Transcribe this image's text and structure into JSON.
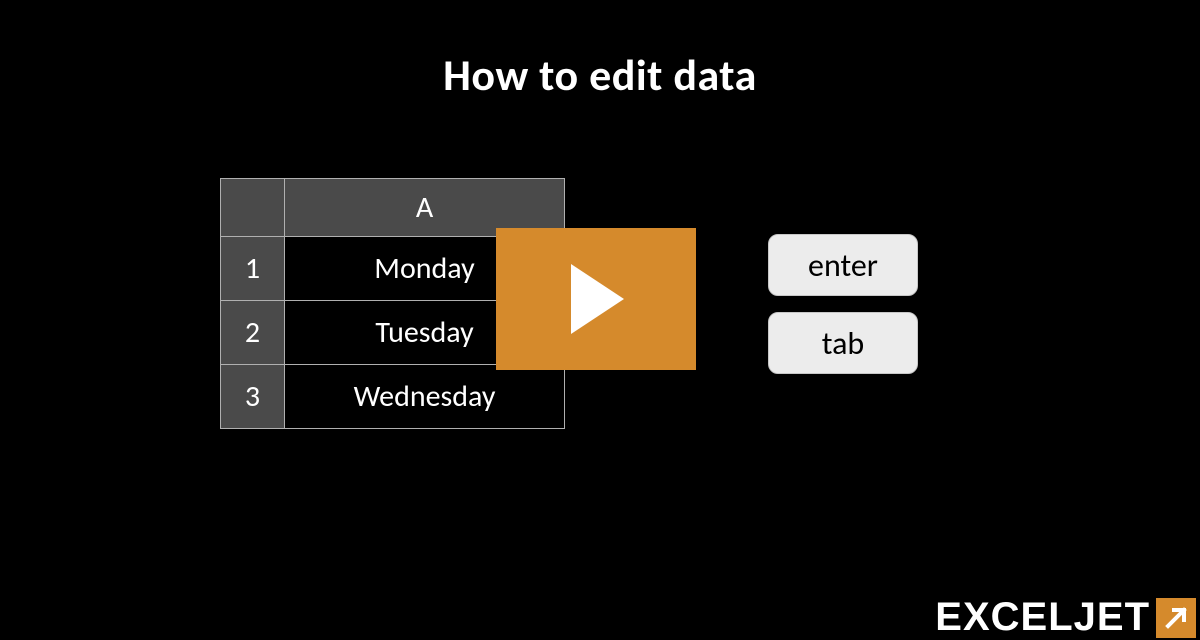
{
  "title": "How to edit data",
  "table": {
    "column_header": "A",
    "rows": [
      {
        "num": "1",
        "value": "Monday"
      },
      {
        "num": "2",
        "value": "Tuesday"
      },
      {
        "num": "3",
        "value": "Wednesday"
      }
    ]
  },
  "keys": {
    "enter": "enter",
    "tab": "tab"
  },
  "logo": {
    "text": "EXCELJET"
  }
}
